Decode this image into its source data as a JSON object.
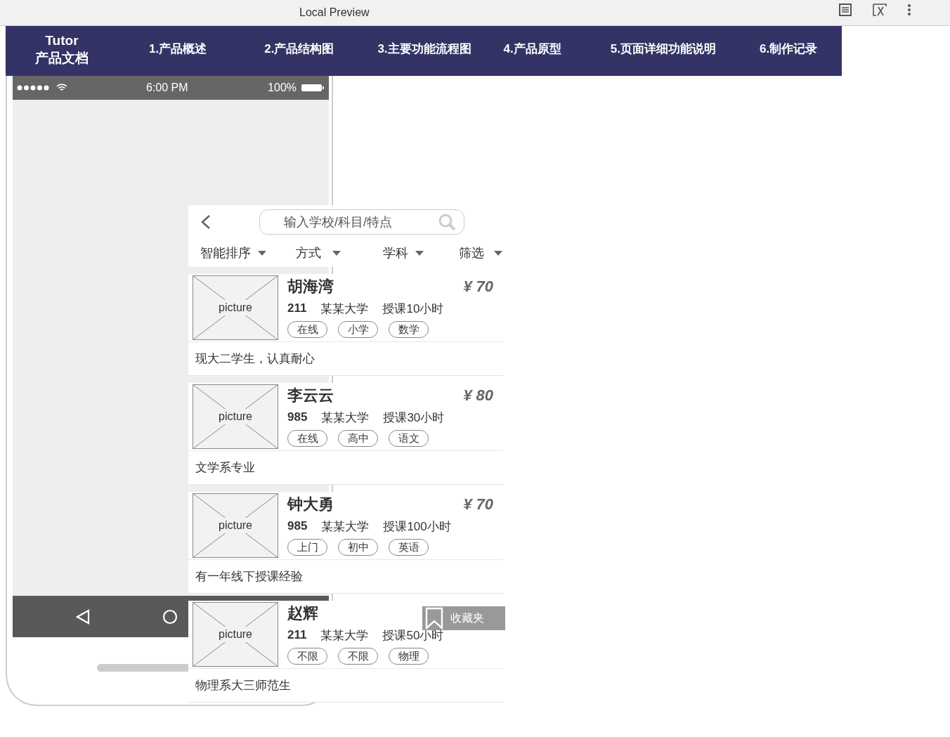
{
  "window": {
    "title": "Local Preview"
  },
  "nav": {
    "brand_lines": [
      "Tutor",
      "产品文档"
    ],
    "items": [
      "1.产品概述",
      "2.产品结构图",
      "3.主要功能流程图",
      "4.产品原型",
      "5.页面详细功能说明",
      "6.制作记录"
    ]
  },
  "status_bar": {
    "time": "6:00 PM",
    "battery": "100%"
  },
  "search": {
    "placeholder": "输入学校/科目/特点"
  },
  "filters": [
    "智能排序",
    "方式",
    "学科",
    "筛选"
  ],
  "tutors": [
    {
      "picture_label": "picture",
      "name": "胡海湾",
      "tier": "211",
      "school": "某某大学",
      "hours": "授课10小时",
      "price": "¥ 70",
      "tags": [
        "在线",
        "小学",
        "数学"
      ],
      "bio": "现大二学生，认真耐心"
    },
    {
      "picture_label": "picture",
      "name": "李云云",
      "tier": "985",
      "school": "某某大学",
      "hours": "授课30小时",
      "price": "¥ 80",
      "tags": [
        "在线",
        "高中",
        "语文"
      ],
      "bio": "文学系专业"
    },
    {
      "picture_label": "picture",
      "name": "钟大勇",
      "tier": "985",
      "school": "某某大学",
      "hours": "授课100小时",
      "price": "¥ 70",
      "tags": [
        "上门",
        "初中",
        "英语"
      ],
      "bio": "有一年线下授课经验"
    },
    {
      "picture_label": "picture",
      "name": "赵辉",
      "tier": "211",
      "school": "某某大学",
      "hours": "授课50小时",
      "tags": [
        "不限",
        "不限",
        "物理"
      ],
      "bio": "物理系大三师范生"
    }
  ],
  "bookmark": {
    "label": "收藏夹"
  }
}
